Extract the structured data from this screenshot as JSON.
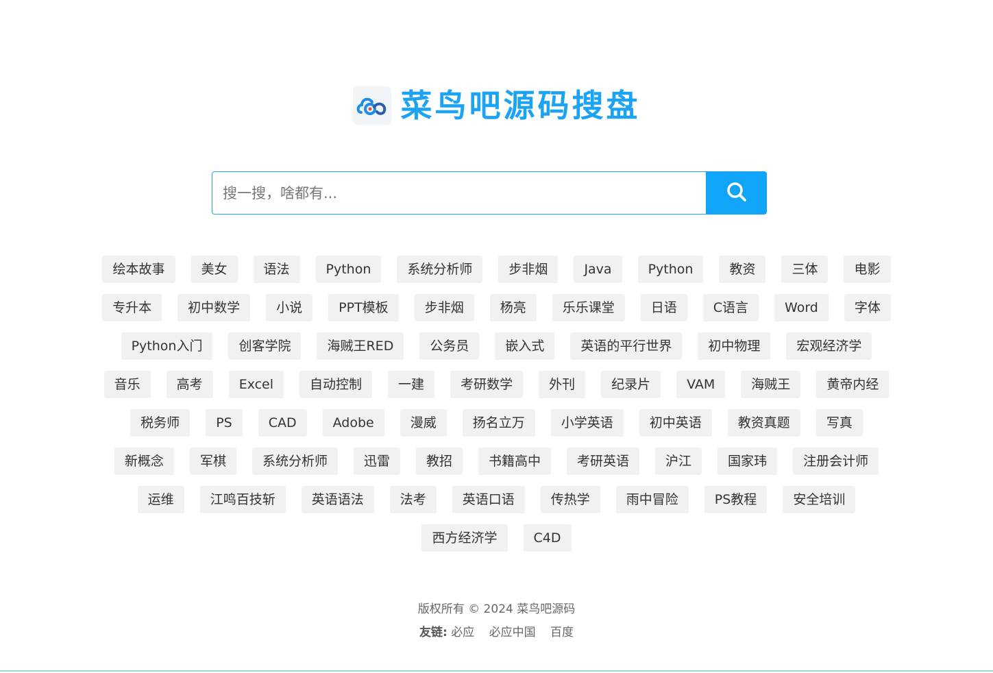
{
  "header": {
    "logo_icon": "cloud-link-icon",
    "title": "菜鸟吧源码搜盘"
  },
  "search": {
    "placeholder": "搜一搜，啥都有...",
    "value": "",
    "button_icon": "search-icon"
  },
  "tags": {
    "rows": [
      [
        "绘本故事",
        "美女",
        "语法",
        "Python",
        "系统分析师",
        "步非烟",
        "Java",
        "Python",
        "教资",
        "三体",
        "电影"
      ],
      [
        "专升本",
        "初中数学",
        "小说",
        "PPT模板",
        "步非烟",
        "杨亮",
        "乐乐课堂",
        "日语",
        "C语言",
        "Word",
        "字体"
      ],
      [
        "Python入门",
        "创客学院",
        "海贼王RED",
        "公务员",
        "嵌入式",
        "英语的平行世界",
        "初中物理",
        "宏观经济学"
      ],
      [
        "音乐",
        "高考",
        "Excel",
        "自动控制",
        "一建",
        "考研数学",
        "外刊",
        "纪录片",
        "VAM",
        "海贼王",
        "黄帝内经"
      ],
      [
        "税务师",
        "PS",
        "CAD",
        "Adobe",
        "漫威",
        "扬名立万",
        "小学英语",
        "初中英语",
        "教资真题",
        "写真"
      ],
      [
        "新概念",
        "军棋",
        "系统分析师",
        "迅雷",
        "教招",
        "书籍高中",
        "考研英语",
        "沪江",
        "国家玮",
        "注册会计师"
      ],
      [
        "运维",
        "江鸣百技斩",
        "英语语法",
        "法考",
        "英语口语",
        "传热学",
        "雨中冒险",
        "PS教程",
        "安全培训"
      ],
      [
        "西方经济学",
        "C4D"
      ]
    ]
  },
  "footer": {
    "copyright": "版权所有 © 2024 菜鸟吧源码",
    "friend_label": "友链:",
    "friend_links": [
      "必应",
      "必应中国",
      "百度"
    ]
  },
  "colors": {
    "brand": "#1ca3f4",
    "search_button": "#10a5f8",
    "tag_bg": "#f1f1f1"
  }
}
